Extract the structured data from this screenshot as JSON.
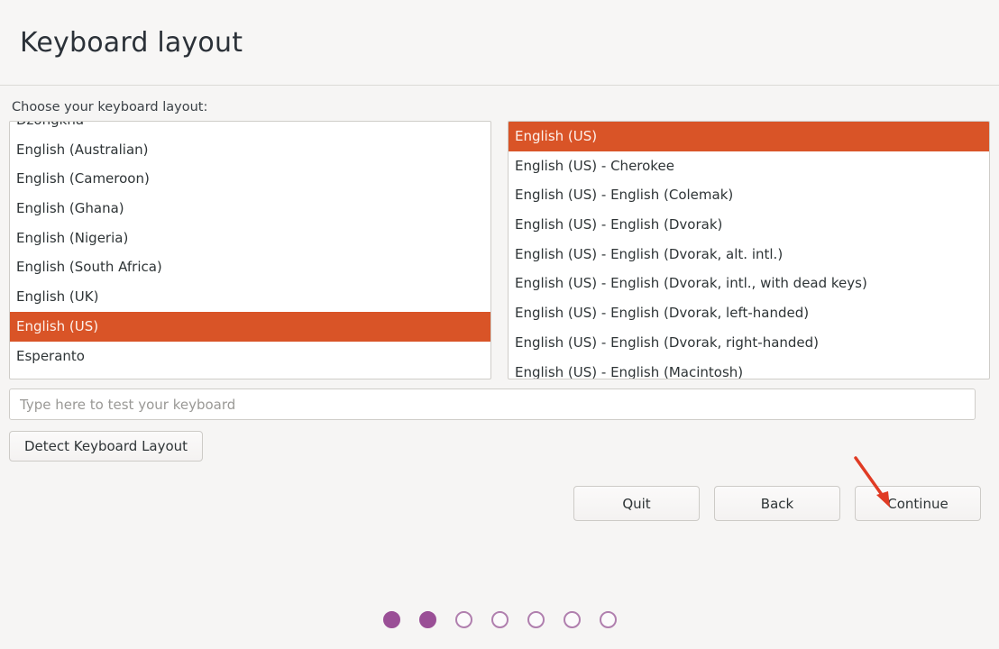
{
  "header": {
    "title": "Keyboard layout"
  },
  "main": {
    "field_label": "Choose your keyboard layout:",
    "language_list": {
      "name": "keyboard-language-list",
      "selected": "English (US)",
      "items": [
        {
          "label": "Dzongkha",
          "selected": false,
          "clipped": true
        },
        {
          "label": "English (Australian)",
          "selected": false
        },
        {
          "label": "English (Cameroon)",
          "selected": false
        },
        {
          "label": "English (Ghana)",
          "selected": false
        },
        {
          "label": "English (Nigeria)",
          "selected": false
        },
        {
          "label": "English (South Africa)",
          "selected": false
        },
        {
          "label": "English (UK)",
          "selected": false
        },
        {
          "label": "English (US)",
          "selected": true
        },
        {
          "label": "Esperanto",
          "selected": false
        }
      ]
    },
    "variant_list": {
      "name": "keyboard-variant-list",
      "selected": "English (US)",
      "items": [
        {
          "label": "English (US)",
          "selected": true
        },
        {
          "label": "English (US) - Cherokee",
          "selected": false
        },
        {
          "label": "English (US) - English (Colemak)",
          "selected": false
        },
        {
          "label": "English (US) - English (Dvorak)",
          "selected": false
        },
        {
          "label": "English (US) - English (Dvorak, alt. intl.)",
          "selected": false
        },
        {
          "label": "English (US) - English (Dvorak, intl., with dead keys)",
          "selected": false
        },
        {
          "label": "English (US) - English (Dvorak, left-handed)",
          "selected": false
        },
        {
          "label": "English (US) - English (Dvorak, right-handed)",
          "selected": false
        },
        {
          "label": "English (US) - English (Macintosh)",
          "selected": false,
          "clipped": true
        }
      ]
    },
    "test_input": {
      "placeholder": "Type here to test your keyboard",
      "value": ""
    },
    "detect_button": "Detect Keyboard Layout"
  },
  "footer": {
    "quit_label": "Quit",
    "back_label": "Back",
    "continue_label": "Continue",
    "progress_dots": [
      {
        "filled": true
      },
      {
        "filled": true
      },
      {
        "filled": false
      },
      {
        "filled": false
      },
      {
        "filled": false
      },
      {
        "filled": false
      },
      {
        "filled": false
      }
    ],
    "progress_current": 2,
    "progress_total": 7
  },
  "annotation": {
    "arrow_color": "#e03b24",
    "arrow_target": "continue-button"
  },
  "colors": {
    "selection_orange": "#d95427",
    "progress_purple": "#9a4f96",
    "page_background": "#f6f5f4"
  }
}
